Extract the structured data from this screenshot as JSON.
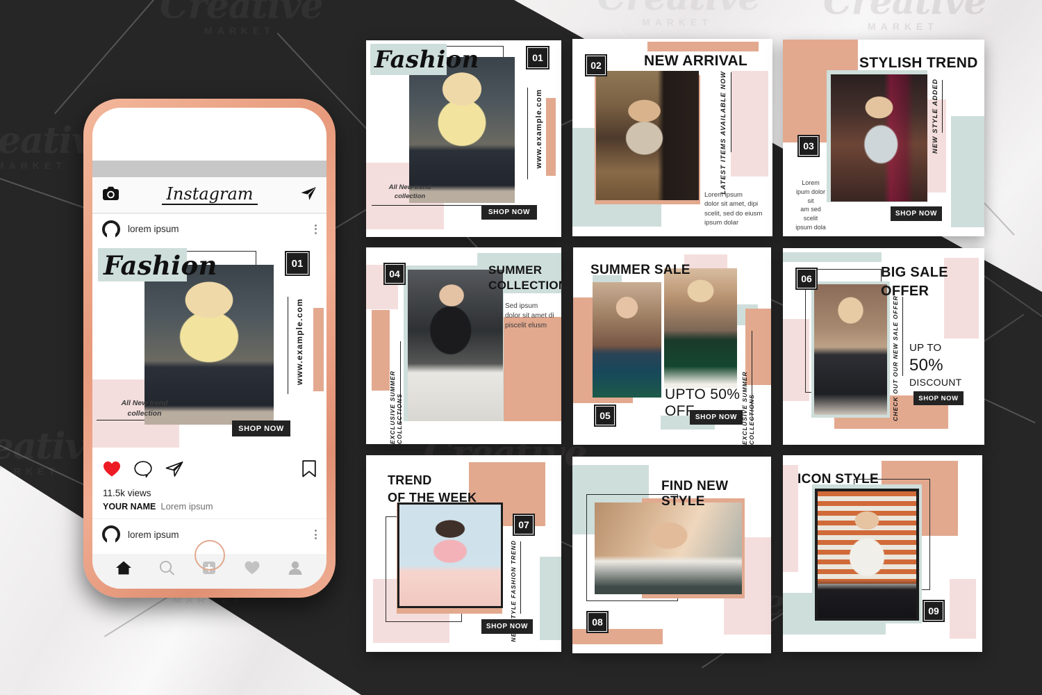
{
  "background": {
    "dark_color": "#272626",
    "accent_peach": "#E2A98F",
    "accent_mint": "#CBDCD8",
    "accent_blush": "#F3DDDC",
    "ink": "#1D1D1D"
  },
  "watermark": {
    "line1": "Creative",
    "line2": "MARKET"
  },
  "phone": {
    "app_title": "Instagram",
    "camera_icon": "camera-icon",
    "send_icon": "send-icon",
    "post_author": "lorem ipsum",
    "second_post_author": "lorem ipsum",
    "views": "11.5k views",
    "caption_name": "YOUR NAME",
    "caption_text": "Lorem ipsum",
    "actions": [
      "heart-icon",
      "comment-icon",
      "share-icon",
      "bookmark-icon"
    ],
    "tabbar": [
      "home-icon",
      "search-icon",
      "add-icon",
      "activity-icon",
      "profile-icon"
    ]
  },
  "cards": [
    {
      "number": "01",
      "title": "Fashion",
      "title_style": "script",
      "vertical_text": "www.example.com",
      "body": "All New trend\ncollection",
      "cta": "SHOP NOW"
    },
    {
      "number": "02",
      "title": "NEW ARRIVAL",
      "vertical_text": "LATEST ITEMS AVAILABLE NOW",
      "body": "Lorem ipsum\ndolor sit amet, dipi\nscelit, sed do eiusm\nipsum dolar",
      "cta": ""
    },
    {
      "number": "03",
      "title": "STYLISH TREND",
      "vertical_text": "NEW STYLE ADDED",
      "body": "Lorem\nipum dolor sit\nam sed scelit\nipsum dola",
      "cta": "SHOP NOW"
    },
    {
      "number": "04",
      "title": "SUMMER\nCOLLECTION",
      "vertical_text": "EXCLUSIVE SUMMER COLLECTIONS",
      "body": "Sed ipsum\ndolor sit amet di\npiscelit elusm",
      "cta": ""
    },
    {
      "number": "05",
      "title": "SUMMER SALE",
      "vertical_text": "EXCLUSIVE SUMMER COLLECTIONS",
      "body": "UPTO 50% OFF",
      "cta": "SHOP NOW"
    },
    {
      "number": "06",
      "title": "BIG SALE\nOFFER",
      "vertical_text": "CHECK OUT OUR NEW SALE OFFER",
      "body": "UP TO",
      "body2": "50%",
      "body3": "DISCOUNT",
      "cta": "SHOP NOW"
    },
    {
      "number": "07",
      "title": "TREND\nOF THE WEEK",
      "vertical_text": "NEW STYLE FASHION TREND",
      "body": "",
      "cta": "SHOP NOW"
    },
    {
      "number": "08",
      "title": "FIND NEW STYLE",
      "vertical_text": "",
      "body": "",
      "cta": ""
    },
    {
      "number": "09",
      "title": "ICON STYLE",
      "vertical_text": "",
      "body": "",
      "cta": ""
    }
  ]
}
